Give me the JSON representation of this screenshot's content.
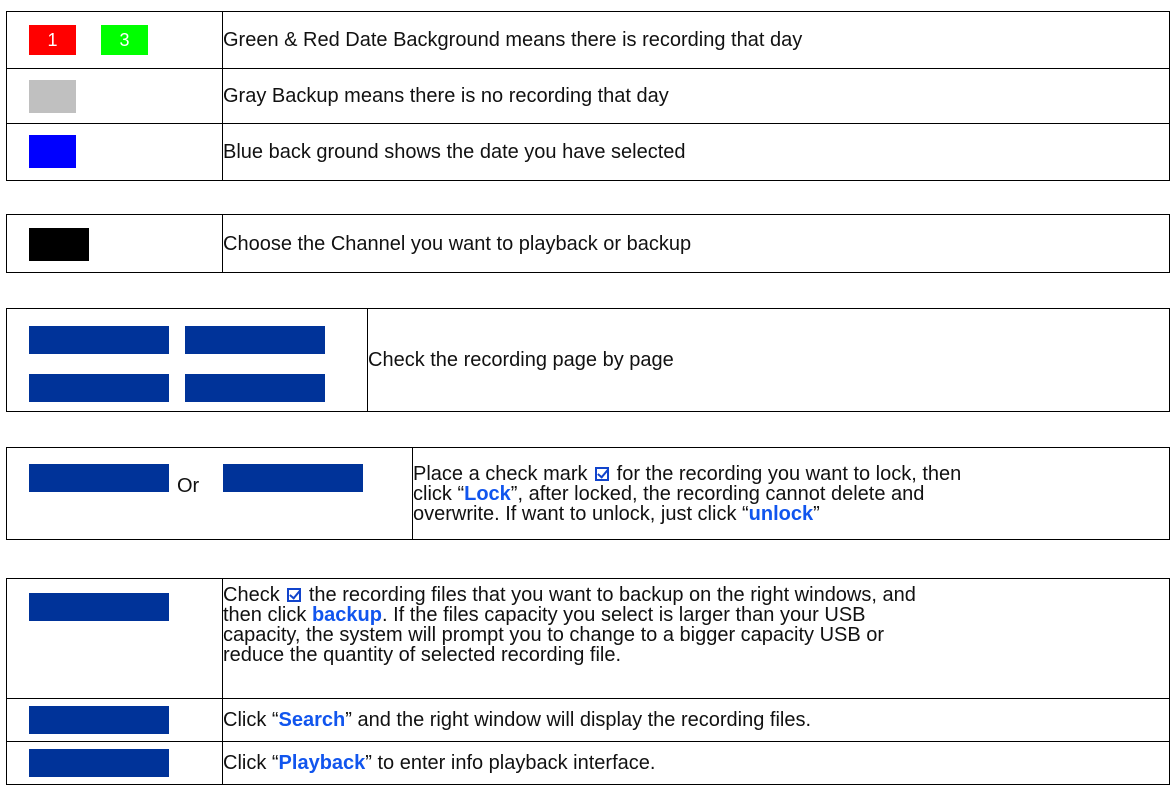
{
  "legend": {
    "red_date": "1",
    "green_date": "3",
    "colors": {
      "red": "#ff0000",
      "green": "#00ff00",
      "gray": "#c0c0c0",
      "blue": "#0000ff",
      "black": "#000000",
      "button_navy": "#003399",
      "keyword_blue": "#1155ee"
    },
    "rows": [
      "Green & Red Date Background means there is recording that day",
      "Gray Backup means there is no recording that day",
      "Blue back ground shows the date you have selected"
    ]
  },
  "channel": {
    "text": "Choose the Channel you want to playback or backup"
  },
  "paging": {
    "text": "Check the recording page by page"
  },
  "lock": {
    "or_label": "Or",
    "line1_prefix": "Place a check mark",
    "line1_suffix": "for the recording you want to lock, then",
    "line2_prefix": "click “",
    "line2_keyword": "Lock",
    "line2_suffix": "”, after locked, the recording cannot delete and",
    "line3": "overwrite. If want to unlock, just click “",
    "line3_keyword": "unlock",
    "line3_end": "”"
  },
  "backup": {
    "line1_prefix": "Check",
    "line1_suffix": "the recording files that you want to backup on the right windows, and",
    "line2_prefix": "then click",
    "line2_keyword": "backup",
    "line2_suffix": ".  If the files capacity you select is larger than your USB",
    "line3": "capacity, the system will prompt you to change to a bigger capacity USB or",
    "line4": "reduce the quantity of selected recording file."
  },
  "search": {
    "prefix": "Click “",
    "keyword": "Search",
    "suffix": "” and the right window will display the recording files."
  },
  "playback": {
    "prefix": "Click “",
    "keyword": "Playback",
    "suffix": "” to enter info playback interface."
  }
}
